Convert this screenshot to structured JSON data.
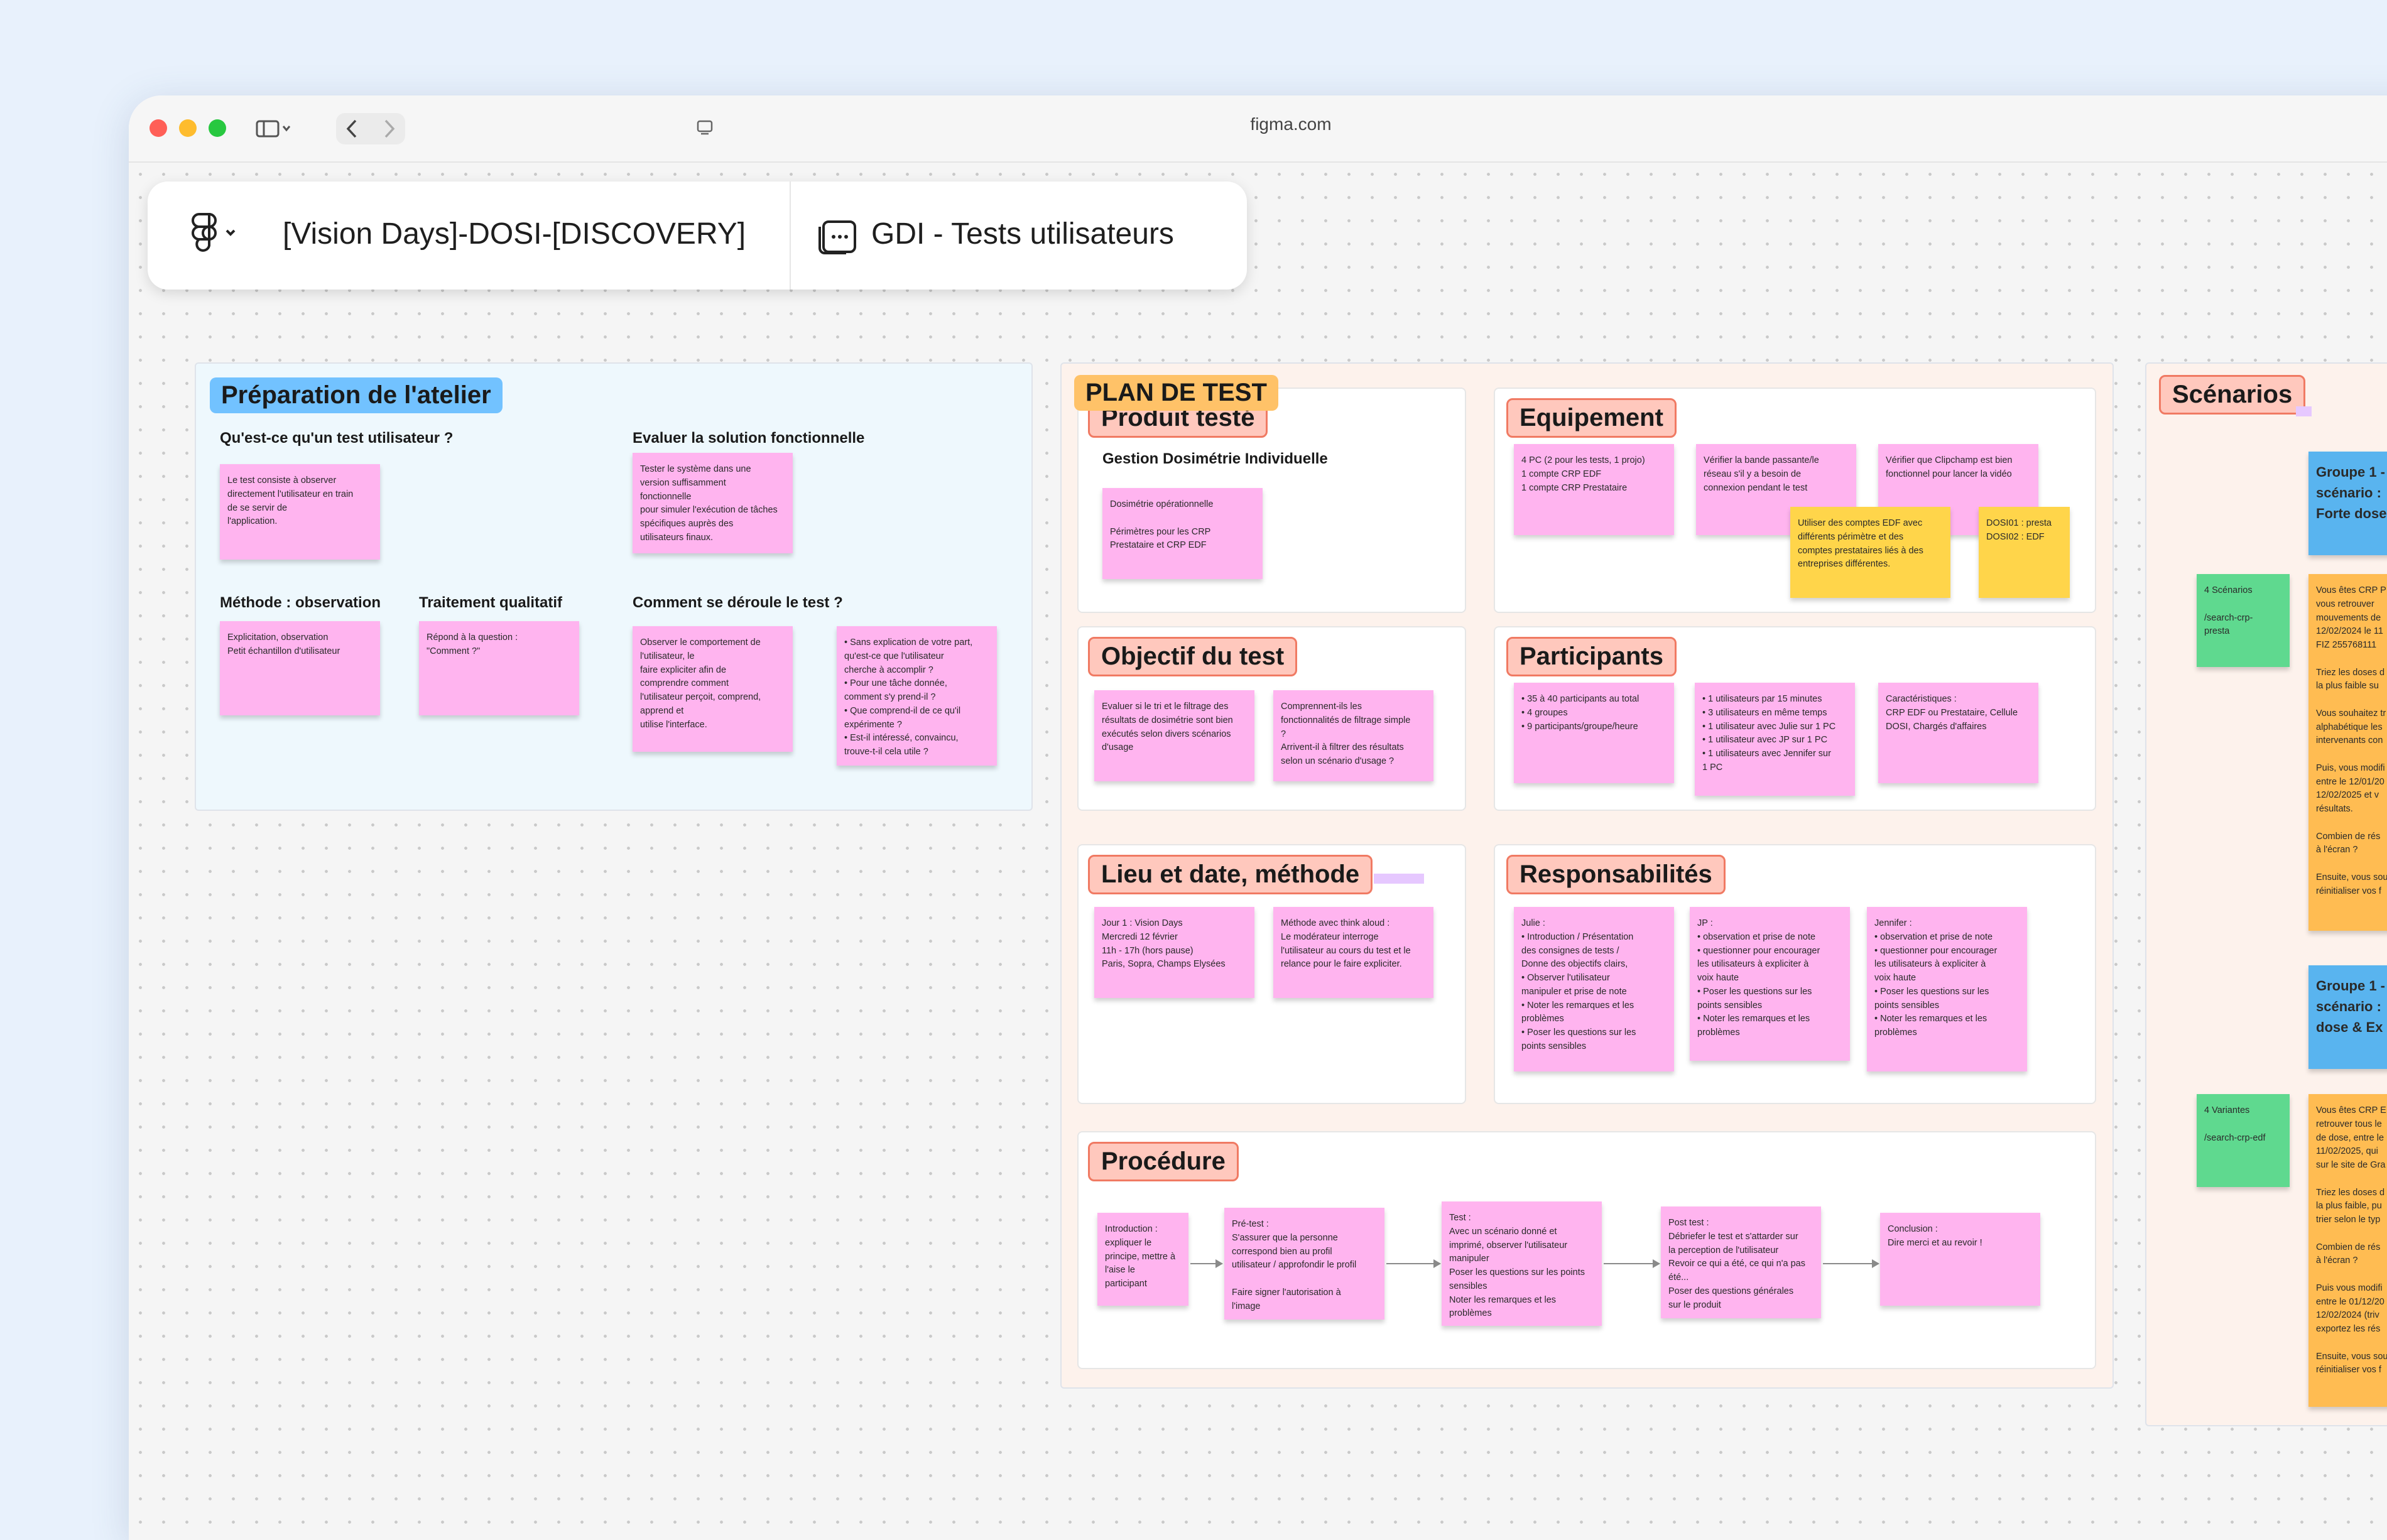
{
  "browser": {
    "url": "figma.com",
    "traffic_colors": [
      "#ff5f57",
      "#febc2e",
      "#28c840"
    ]
  },
  "filebar": {
    "project": "[Vision Days]-DOSI-[DISCOVERY]",
    "file": "GDI - Tests utilisateurs"
  },
  "preparation": {
    "title": "Préparation de l'atelier",
    "q1_label": "Qu'est-ce qu'un test utilisateur ?",
    "q1_text": "Le test consiste à observer\ndirectement l'utilisateur en train\nde se servir de\nl'application.",
    "q2_label": "Evaluer la solution fonctionnelle",
    "q2_text": "Tester le système dans une\nversion suffisamment\nfonctionnelle\npour simuler l'exécution de tâches\nspécifiques auprès des\nutilisateurs finaux.",
    "q3_label": "Méthode : observation",
    "q3_text": "Explicitation, observation\nPetit échantillon d'utilisateur",
    "q4_label": "Traitement qualitatif",
    "q4_text": "Répond à la question :\n\"Comment ?\"",
    "q5_label": "Comment se déroule le test ?",
    "q5_text": "Observer le comportement de\nl'utilisateur, le\nfaire expliciter afin de\ncomprendre comment\nl'utilisateur perçoit, comprend,\napprend et\nutilise l'interface.",
    "q6_text": "• Sans explication de votre part,\n  qu'est-ce que l'utilisateur\n  cherche à accomplir ?\n• Pour une tâche donnée,\n  comment s'y prend-il ?\n• Que comprend-il de ce qu'il\n  expérimente ?\n• Est-il intéressé, convaincu,\n  trouve-t-il cela utile ?"
  },
  "plan": {
    "title": "PLAN DE TEST",
    "produit": {
      "title": "Produit testé",
      "subtitle": "Gestion Dosimétrie Individuelle",
      "sticky": "Dosimétrie opérationnelle\n\nPérimètres pour les CRP\nPrestataire et CRP EDF"
    },
    "equipement": {
      "title": "Equipement",
      "s1": "4 PC (2 pour les tests, 1 projo)\n1 compte CRP EDF\n1 compte CRP Prestataire",
      "s2": "Vérifier la bande passante/le\nréseau s'il y a besoin de\nconnexion pendant le test",
      "s3": "Vérifier que Clipchamp est bien\nfonctionnel pour lancer la vidéo",
      "s4": "Utiliser des comptes EDF avec\ndifférents périmètre et des\ncomptes prestataires liés à des\nentreprises différentes.",
      "s5": "DOSI01 : presta\nDOSI02 : EDF"
    },
    "objectif": {
      "title": "Objectif du test",
      "s1": "Evaluer si le tri et le filtrage des\nrésultats de dosimétrie sont bien\nexécutés selon divers scénarios\nd'usage",
      "s2": "Comprennent-ils les\nfonctionnalités de filtrage simple\n?\nArrivent-il à filtrer des résultats\nselon un scénario d'usage ?"
    },
    "participants": {
      "title": "Participants",
      "s1": "• 35 à 40 participants au total\n• 4 groupes\n• 9 participants/groupe/heure",
      "s2": "• 1 utilisateurs par 15 minutes\n• 3 utilisateurs en même temps\n• 1 utilisateur avec Julie sur 1 PC\n• 1 utilisateur  avec JP sur 1 PC\n• 1 utilisateurs  avec Jennifer sur\n  1 PC",
      "s3": "Caractéristiques :\nCRP EDF ou Prestataire, Cellule\nDOSI, Chargés d'affaires"
    },
    "lieu": {
      "title": "Lieu et date, méthode",
      "s1": "Jour 1 : Vision Days\nMercredi 12 février\n11h - 17h (hors pause)\nParis, Sopra, Champs Elysées",
      "s2": "Méthode avec think aloud :\nLe modérateur interroge\nl'utilisateur au cours du test et le\nrelance pour le faire expliciter."
    },
    "responsabilites": {
      "title": "Responsabilités",
      "s1": "Julie :\n• Introduction / Présentation\n  des consignes de tests /\n  Donne des objectifs clairs,\n• Observer l'utilisateur\n  manipuler et prise de note\n• Noter les remarques et les\n  problèmes\n• Poser les questions sur les\n  points sensibles",
      "s2": "JP :\n• observation et prise de note\n• questionner pour encourager\n  les utilisateurs à expliciter à\n  voix haute\n• Poser les questions sur les\n  points sensibles\n• Noter les remarques et les\n  problèmes",
      "s3": "Jennifer :\n• observation et prise de note\n• questionner pour encourager\n  les utilisateurs à expliciter à\n  voix haute\n• Poser les questions sur les\n  points sensibles\n• Noter les remarques et les\n  problèmes"
    },
    "procedure": {
      "title": "Procédure",
      "s1": "Introduction :\nexpliquer le\nprincipe, mettre à\nl'aise le\nparticipant",
      "s2": "Pré-test :\nS'assurer que la personne\ncorrespond bien au profil\nutilisateur / approfondir le profil\n\nFaire signer l'autorisation à\nl'image",
      "s3": "Test :\nAvec un scénario donné et\nimprimé, observer l'utilisateur\nmanipuler\nPoser les questions sur les points\nsensibles\nNoter les remarques et les\nproblèmes",
      "s4": "Post test :\nDébriefer le test et s'attarder sur\nla perception de l'utilisateur\nRevoir ce qui a été, ce qui n'a pas\nété...\nPoser des questions générales\nsur le produit",
      "s5": "Conclusion :\nDire merci et au revoir !"
    }
  },
  "scenarios": {
    "title": "Scénarios",
    "g1": "Groupe 1 -\nscénario :\nForte dose",
    "g2": "Groupe 1 -\nscénario :\ndose & Ex",
    "sc1": "4 Scénarios\n\n/search-crp-\npresta",
    "sc2": "4 Variantes\n\n/search-crp-edf",
    "o1": "Vous êtes CRP P\nvous retrouver\nmouvements de\n12/02/2024 le 11\nFIZ 255768111\n\nTriez les doses d\nla plus faible su\n\nVous souhaitez tr\nalphabétique les\nintervenants con\n\nPuis, vous modifi\nentre le 12/01/20\n12/02/2025 et v\nrésultats.\n\nCombien de rés\nà l'écran ?\n\nEnsuite, vous sou\nréinitialiser vos f",
    "o2": "Vous êtes CRP E\nretrouver tous le\nde dose, entre le\n11/02/2025, qui\nsur le site de Gra\n\nTriez les doses d\nla plus faible, pu\ntrier selon le typ\n\nCombien de rés\nà l'écran ?\n\nPuis vous modifi\nentre le 01/12/20\n12/02/2024 (triv\nexportez les rés\n\nEnsuite, vous sou\nréinitialiser vos f"
  }
}
